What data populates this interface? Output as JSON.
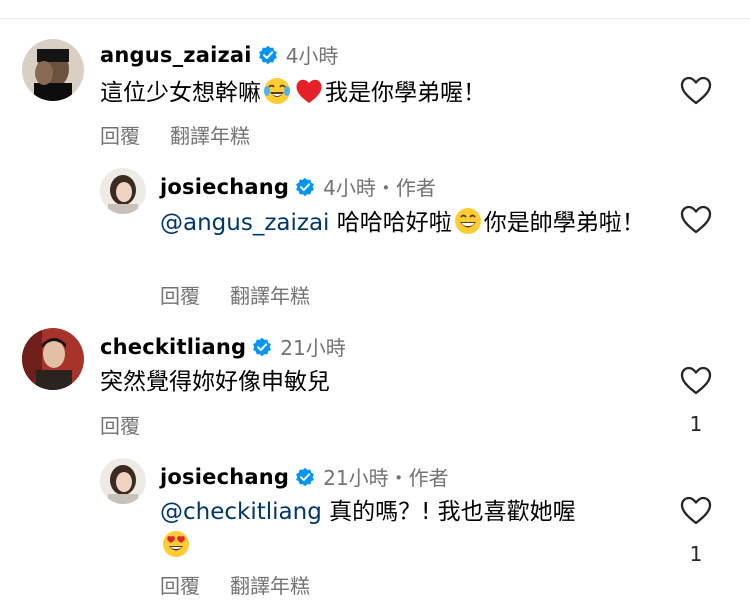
{
  "comments": [
    {
      "username": "angus_zaizai",
      "time": "4小時",
      "text_before": "這位少女想幹嘛",
      "text_after": "我是你學弟喔！",
      "emojis": [
        "face-with-tears-of-joy",
        "red-heart"
      ],
      "reply_label": "回覆",
      "translate_label": "翻譯年糕"
    },
    {
      "username": "josiechang",
      "time": "4小時・作者",
      "mention": "@angus_zaizai",
      "text_before": " 哈哈哈好啦",
      "text_after": "你是帥學弟啦！",
      "emojis": [
        "grinning-face"
      ],
      "reply_label": "回覆",
      "translate_label": "翻譯年糕"
    },
    {
      "username": "checkitliang",
      "time": "21小時",
      "text": "突然覺得妳好像申敏兒",
      "like_count": "1",
      "reply_label": "回覆"
    },
    {
      "username": "josiechang",
      "time": "21小時・作者",
      "mention": "@checkitliang",
      "text": " 真的嗎？! 我也喜歡她喔",
      "emojis": [
        "heart-eyes-face"
      ],
      "like_count": "1",
      "reply_label": "回覆",
      "translate_label": "翻譯年糕"
    }
  ],
  "colors": {
    "mention": "#00376b",
    "verified": "#0095f6",
    "meta": "#737373"
  }
}
